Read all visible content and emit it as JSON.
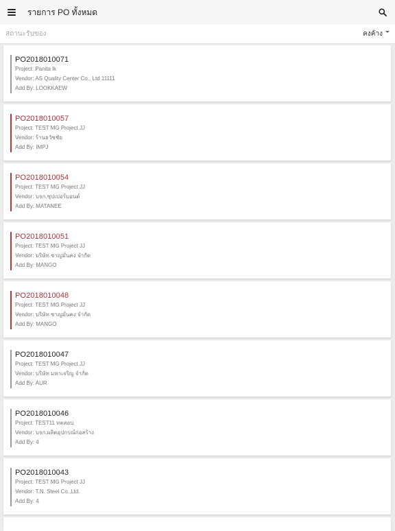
{
  "header": {
    "title": "รายการ PO ทั้งหมด",
    "menu_icon": "menu-icon",
    "search_icon": "search-icon"
  },
  "filter": {
    "label": "สถานะรับของ",
    "selected": "คงค้าง"
  },
  "colors": {
    "alert": "#b4373e",
    "normal": "#9a9a9a"
  },
  "orders": [
    {
      "po": "PO2018010071",
      "project": "Project: Panita lk",
      "vendor": "Vendor: AS Quality Center Co., Ltd 11111",
      "add_by": "Add By: LOOKKAEW",
      "status": "normal"
    },
    {
      "po": "PO2018010057",
      "project": "Project: TEST MG Project JJ",
      "vendor": "Vendor: ร้านธวัชชัย",
      "add_by": "Add By: IMPJ",
      "status": "alert"
    },
    {
      "po": "PO2018010054",
      "project": "Project: TEST MG Project JJ",
      "vendor": "Vendor: บจก.ซุปเปอร์บอนด์",
      "add_by": "Add By: MATANEE",
      "status": "alert"
    },
    {
      "po": "PO2018010051",
      "project": "Project: TEST MG Project JJ",
      "vendor": "Vendor: บริษัท ชาญมั่นคง จำกัด",
      "add_by": "Add By: MANGO",
      "status": "alert"
    },
    {
      "po": "PO2018010048",
      "project": "Project: TEST MG Project JJ",
      "vendor": "Vendor: บริษัท ชาญมั่นคง จำกัด",
      "add_by": "Add By: MANGO",
      "status": "alert"
    },
    {
      "po": "PO2018010047",
      "project": "Project: TEST MG Project JJ",
      "vendor": "Vendor: บริษัท มหาเจริญ จำกัด",
      "add_by": "Add By: AUR",
      "status": "normal"
    },
    {
      "po": "PO2018010046",
      "project": "Project: TEST11 ทดสอบ",
      "vendor": "Vendor: บจก.ผลิตอุปกรณ์ก่อสร้าง",
      "add_by": "Add By: 4",
      "status": "normal"
    },
    {
      "po": "PO2018010043",
      "project": "Project: TEST MG Project JJ",
      "vendor": "Vendor: T.N. Steel Co.,Ltd.",
      "add_by": "Add By: 4",
      "status": "normal"
    }
  ]
}
